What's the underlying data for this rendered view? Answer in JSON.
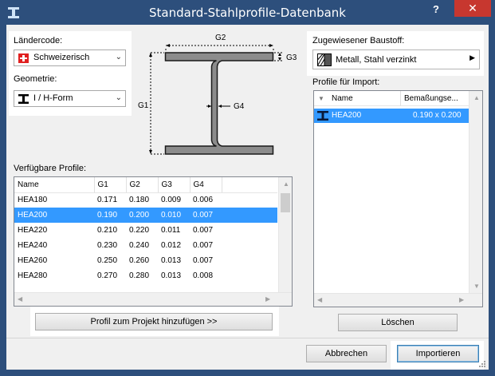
{
  "window": {
    "title": "Standard-Stahlprofile-Datenbank",
    "help": "?",
    "close": "✕"
  },
  "country": {
    "label": "Ländercode:",
    "value": "Schweizerisch"
  },
  "geometry": {
    "label": "Geometrie:",
    "value": "I / H-Form"
  },
  "diagram": {
    "g1": "G1",
    "g2": "G2",
    "g3": "G3",
    "g4": "G4"
  },
  "material": {
    "label": "Zugewiesener Baustoff:",
    "value": "Metall, Stahl verzinkt"
  },
  "available": {
    "label": "Verfügbare Profile:",
    "columns": [
      "Name",
      "G1",
      "G2",
      "G3",
      "G4"
    ],
    "rows": [
      [
        "HEA180",
        "0.171",
        "0.180",
        "0.009",
        "0.006"
      ],
      [
        "HEA200",
        "0.190",
        "0.200",
        "0.010",
        "0.007"
      ],
      [
        "HEA220",
        "0.210",
        "0.220",
        "0.011",
        "0.007"
      ],
      [
        "HEA240",
        "0.230",
        "0.240",
        "0.012",
        "0.007"
      ],
      [
        "HEA260",
        "0.250",
        "0.260",
        "0.013",
        "0.007"
      ],
      [
        "HEA280",
        "0.270",
        "0.280",
        "0.013",
        "0.008"
      ]
    ],
    "selected_index": 1
  },
  "add_button": "Profil zum Projekt hinzufügen >>",
  "import": {
    "label": "Profile für Import:",
    "columns": [
      "Name",
      "Bemaßungse..."
    ],
    "rows": [
      [
        "HEA200",
        "0.190 x 0.200"
      ]
    ]
  },
  "delete_button": "Löschen",
  "cancel_button": "Abbrechen",
  "import_button": "Importieren"
}
